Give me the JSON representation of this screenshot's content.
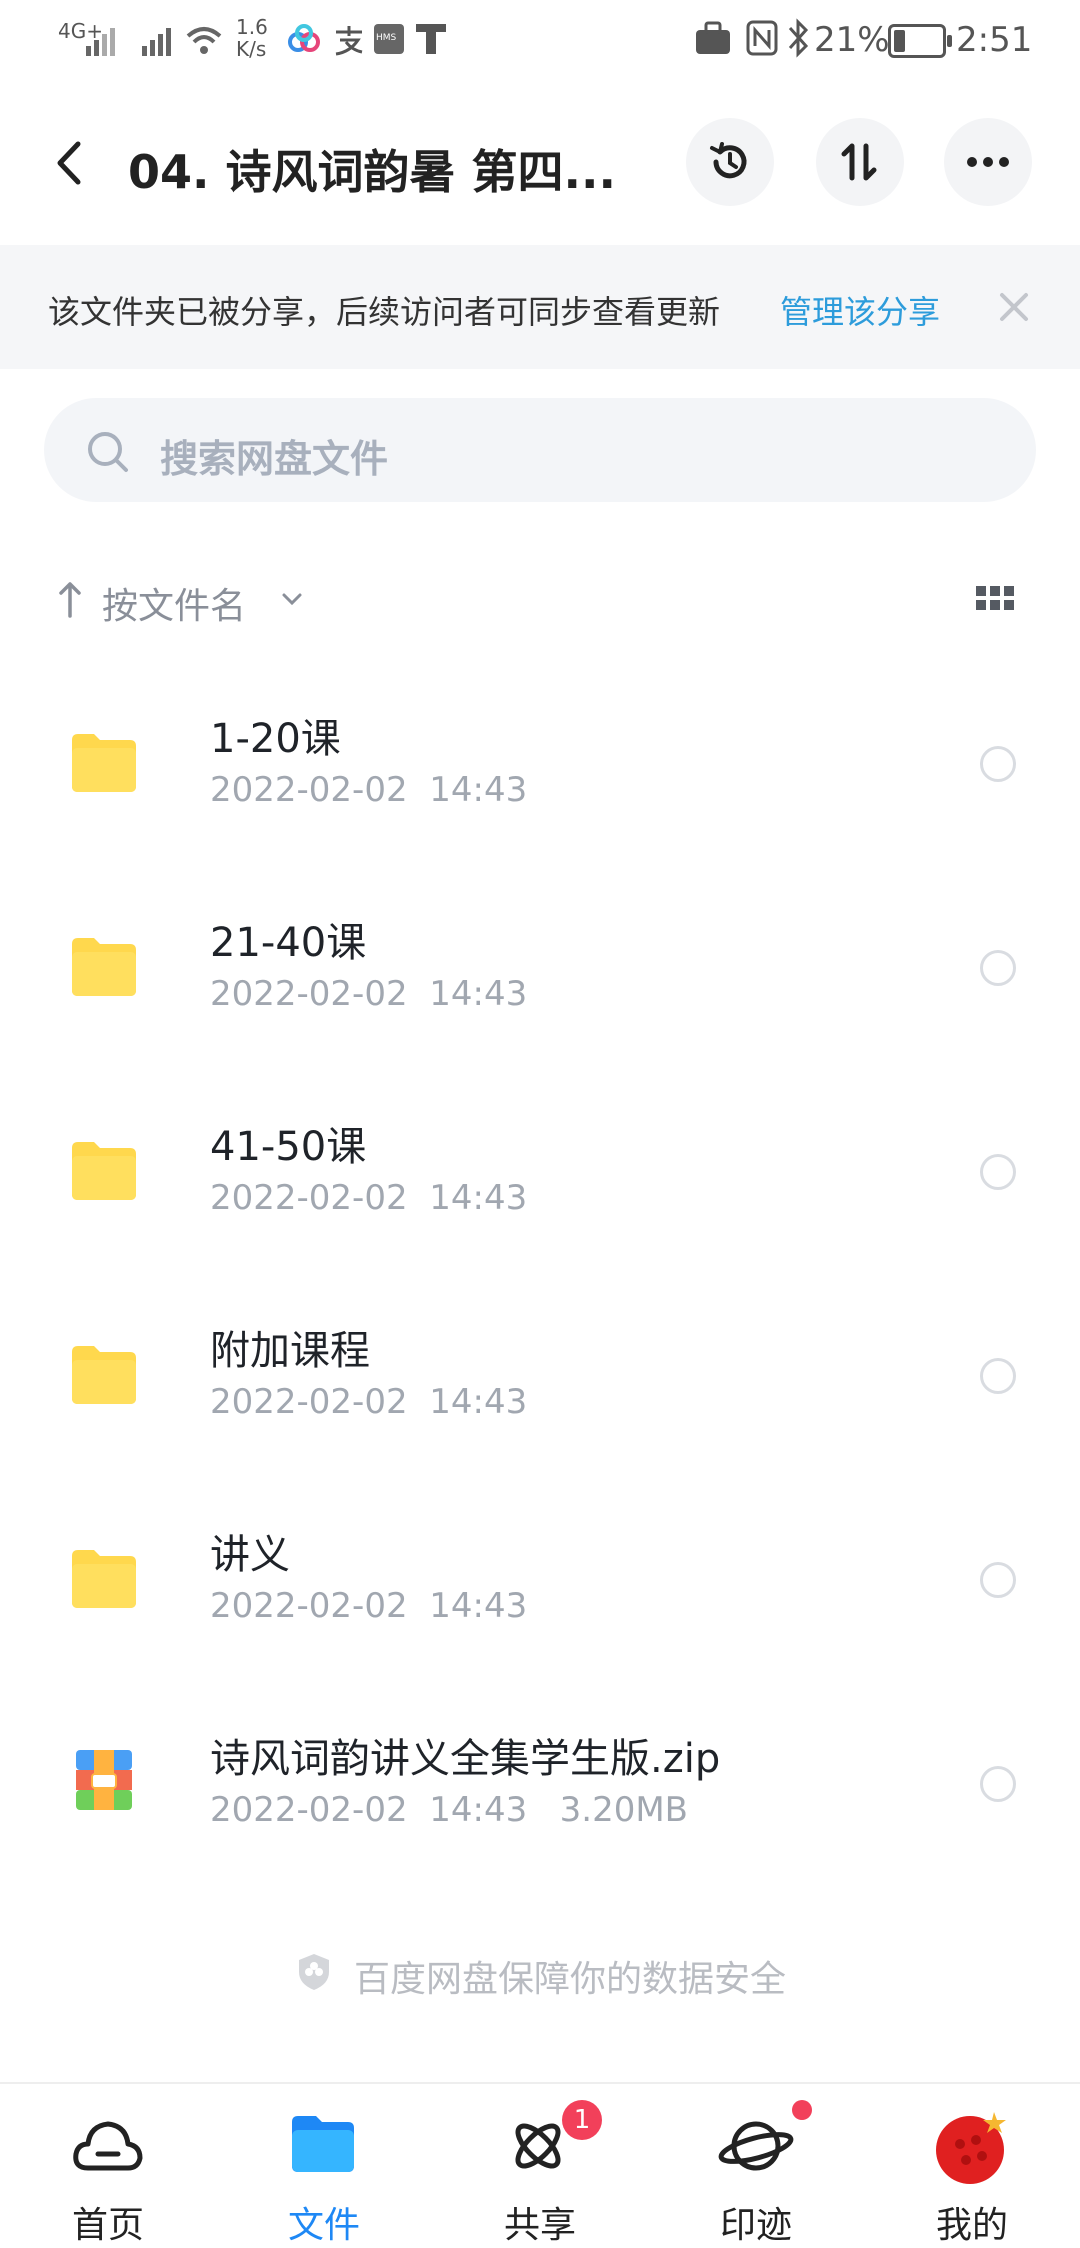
{
  "status_bar": {
    "network": "4G+",
    "speed_value": "1.6",
    "speed_unit": "K/s",
    "hms": "HMS",
    "battery": "21%",
    "time": "2:51"
  },
  "header": {
    "title": "04. 诗风词韵暑 第四..."
  },
  "notice": {
    "text": "该文件夹已被分享，后续访问者可同步查看更新",
    "link": "管理该分享"
  },
  "search": {
    "placeholder": "搜索网盘文件"
  },
  "sort": {
    "label": "按文件名"
  },
  "files": [
    {
      "name": "1-20课",
      "date": "2022-02-02",
      "time": "14:43",
      "size": "",
      "type": "folder"
    },
    {
      "name": "21-40课",
      "date": "2022-02-02",
      "time": "14:43",
      "size": "",
      "type": "folder"
    },
    {
      "name": "41-50课",
      "date": "2022-02-02",
      "time": "14:43",
      "size": "",
      "type": "folder"
    },
    {
      "name": "附加课程",
      "date": "2022-02-02",
      "time": "14:43",
      "size": "",
      "type": "folder"
    },
    {
      "name": "讲义",
      "date": "2022-02-02",
      "time": "14:43",
      "size": "",
      "type": "folder"
    },
    {
      "name": "诗风词韵讲义全集学生版.zip",
      "date": "2022-02-02",
      "time": "14:43",
      "size": "3.20MB",
      "type": "zip"
    }
  ],
  "footer": {
    "text": "百度网盘保障你的数据安全"
  },
  "bottom_nav": {
    "items": [
      {
        "label": "首页",
        "icon": "cloud-icon"
      },
      {
        "label": "文件",
        "icon": "folder-icon",
        "active": true
      },
      {
        "label": "共享",
        "icon": "atom-icon",
        "badge": "1"
      },
      {
        "label": "印迹",
        "icon": "planet-icon"
      },
      {
        "label": "我的",
        "icon": "avatar-icon"
      }
    ]
  },
  "colors": {
    "accent": "#1e88f5",
    "link": "#2d9cdb",
    "folder": "#ffd84d",
    "badge": "#f2405a"
  }
}
